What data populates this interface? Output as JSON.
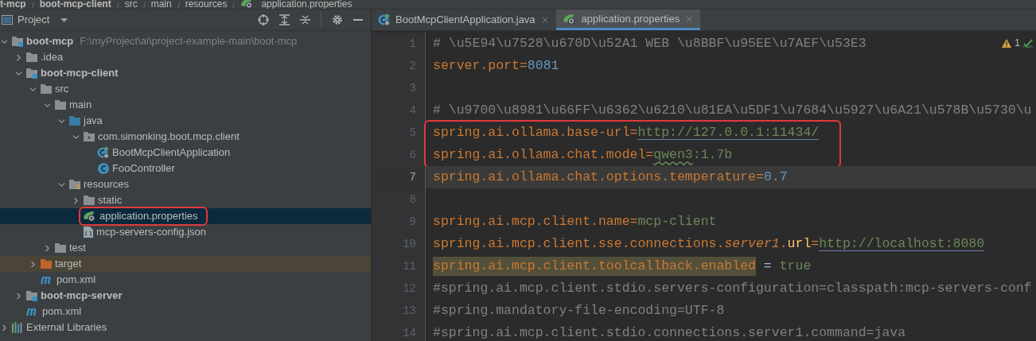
{
  "breadcrumb": [
    {
      "label": "t-mcp",
      "kind": "module"
    },
    {
      "label": "boot-mcp-client",
      "kind": "module"
    },
    {
      "label": "src",
      "kind": "folder"
    },
    {
      "label": "main",
      "kind": "folder"
    },
    {
      "label": "resources",
      "kind": "folder"
    },
    {
      "label": "application.properties",
      "kind": "spring_props"
    }
  ],
  "project_panel": {
    "title": "Project"
  },
  "tree": [
    {
      "label": "boot-mcp",
      "path": "F:\\myProject\\ai\\project-example-main\\boot-mcp",
      "kind": "module",
      "expanded": true,
      "selected": false,
      "excluded": false,
      "annotated": false,
      "children": [
        {
          "label": ".idea",
          "kind": "folder",
          "expanded": false,
          "selected": false,
          "excluded": false,
          "annotated": false
        },
        {
          "label": "boot-mcp-client",
          "kind": "module",
          "expanded": true,
          "selected": false,
          "excluded": false,
          "annotated": false,
          "children": [
            {
              "label": "src",
              "kind": "folder",
              "expanded": true,
              "selected": false,
              "excluded": false,
              "annotated": false,
              "children": [
                {
                  "label": "main",
                  "kind": "folder",
                  "expanded": true,
                  "selected": false,
                  "excluded": false,
                  "annotated": false,
                  "children": [
                    {
                      "label": "java",
                      "kind": "source_folder",
                      "expanded": true,
                      "selected": false,
                      "excluded": false,
                      "annotated": false,
                      "children": [
                        {
                          "label": "com.simonking.boot.mcp.client",
                          "kind": "package",
                          "expanded": true,
                          "selected": false,
                          "excluded": false,
                          "annotated": false,
                          "children": [
                            {
                              "label": "BootMcpClientApplication",
                              "kind": "spring_class",
                              "selected": false,
                              "excluded": false,
                              "annotated": false
                            },
                            {
                              "label": "FooController",
                              "kind": "class",
                              "selected": false,
                              "excluded": false,
                              "annotated": false
                            }
                          ]
                        }
                      ]
                    },
                    {
                      "label": "resources",
                      "kind": "resources_folder",
                      "expanded": true,
                      "selected": false,
                      "excluded": false,
                      "annotated": false,
                      "children": [
                        {
                          "label": "static",
                          "kind": "folder",
                          "expanded": false,
                          "selected": false,
                          "excluded": false,
                          "annotated": false
                        },
                        {
                          "label": "application.properties",
                          "kind": "spring_props",
                          "selected": true,
                          "excluded": false,
                          "annotated": true
                        },
                        {
                          "label": "mcp-servers-config.json",
                          "kind": "json",
                          "selected": false,
                          "excluded": false,
                          "annotated": false
                        }
                      ]
                    }
                  ]
                },
                {
                  "label": "test",
                  "kind": "folder",
                  "expanded": false,
                  "selected": false,
                  "excluded": false,
                  "annotated": false
                }
              ]
            },
            {
              "label": "target",
              "kind": "excluded_folder",
              "expanded": false,
              "selected": false,
              "excluded": true,
              "annotated": false
            },
            {
              "label": "pom.xml",
              "kind": "maven",
              "selected": false,
              "excluded": false,
              "annotated": false
            }
          ]
        },
        {
          "label": "boot-mcp-server",
          "kind": "module",
          "expanded": false,
          "selected": false,
          "excluded": false,
          "annotated": false
        },
        {
          "label": "pom.xml",
          "kind": "maven",
          "selected": false,
          "excluded": false,
          "annotated": false
        }
      ]
    },
    {
      "label": "External Libraries",
      "kind": "libraries",
      "expanded": false,
      "selected": false,
      "excluded": false,
      "annotated": false
    }
  ],
  "tabs": [
    {
      "label": "BootMcpClientApplication.java",
      "kind": "spring_class",
      "selected": false
    },
    {
      "label": "application.properties",
      "kind": "spring_props",
      "selected": true
    }
  ],
  "inspections": {
    "warnings": "1"
  },
  "code_lines": [
    {
      "number": "1",
      "current": false,
      "boxed": false,
      "segments": [
        {
          "text": "# \\u5E94\\u7528\\u670D\\u52A1 WEB \\u8BBF\\u95EE\\u7AEF\\u53E3",
          "kind": "comment"
        }
      ]
    },
    {
      "number": "2",
      "current": false,
      "boxed": false,
      "segments": [
        {
          "text": "server.port",
          "kind": "key"
        },
        {
          "text": "=",
          "kind": "sep"
        },
        {
          "text": "8081",
          "kind": "number"
        }
      ]
    },
    {
      "number": "3",
      "current": false,
      "boxed": false
    },
    {
      "number": "4",
      "current": false,
      "boxed": false,
      "segments": [
        {
          "text": "# \\u9700\\u8981\\u66FF\\u6362\\u6210\\u81EA\\u5DF1\\u7684\\u5927\\u6A21\\u578B\\u5730\\u",
          "kind": "comment"
        }
      ]
    },
    {
      "number": "5",
      "current": false,
      "boxed": true,
      "segments": [
        {
          "text": "spring.ai.ollama.base-url",
          "kind": "key"
        },
        {
          "text": "=",
          "kind": "sep"
        },
        {
          "text": "http://127.0.0.1:11434/",
          "kind": "url"
        }
      ]
    },
    {
      "number": "6",
      "current": false,
      "boxed": true,
      "segments": [
        {
          "text": "spring.ai.ollama.chat.model",
          "kind": "key"
        },
        {
          "text": "=",
          "kind": "sep"
        },
        {
          "text": "qwen3",
          "kind": "typo"
        },
        {
          "text": ":1.7b",
          "kind": "value"
        }
      ]
    },
    {
      "number": "7",
      "current": true,
      "boxed": false,
      "segments": [
        {
          "text": "spring.ai.ollama.chat.options.temperature",
          "kind": "key"
        },
        {
          "text": "=",
          "kind": "sep"
        },
        {
          "text": "0.7",
          "kind": "number"
        }
      ]
    },
    {
      "number": "8",
      "current": false,
      "boxed": false
    },
    {
      "number": "9",
      "current": false,
      "boxed": false,
      "segments": [
        {
          "text": "spring.ai.mcp.client.name",
          "kind": "key"
        },
        {
          "text": "=",
          "kind": "sep"
        },
        {
          "text": "mcp-client",
          "kind": "value"
        }
      ]
    },
    {
      "number": "10",
      "current": false,
      "boxed": false,
      "segments": [
        {
          "text": "spring.ai.mcp.client.sse.connections.",
          "kind": "key"
        },
        {
          "text": "server1",
          "kind": "italic_key"
        },
        {
          "text": ".",
          "kind": "key"
        },
        {
          "text": "url",
          "kind": "attr"
        },
        {
          "text": "=",
          "kind": "sep"
        },
        {
          "text": "http://localhost:8080",
          "kind": "url"
        }
      ]
    },
    {
      "number": "11",
      "current": false,
      "boxed": false,
      "segments": [
        {
          "text": "spring.ai.mcp.client.toolcallback.enabled",
          "kind": "highlighted_key"
        },
        {
          "text": " = ",
          "kind": "plain"
        },
        {
          "text": "true",
          "kind": "value"
        }
      ]
    },
    {
      "number": "12",
      "current": false,
      "boxed": false,
      "segments": [
        {
          "text": "#spring.ai.mcp.client.stdio.servers-configuration=classpath:mcp-servers-conf",
          "kind": "comment"
        }
      ]
    },
    {
      "number": "13",
      "current": false,
      "boxed": false,
      "segments": [
        {
          "text": "#spring.mandatory-file-encoding=UTF-8",
          "kind": "comment"
        }
      ]
    },
    {
      "number": "14",
      "current": false,
      "boxed": false,
      "segments": [
        {
          "text": "#spring.ai.mcp.client.stdio.connections.server1.command=java",
          "kind": "comment"
        }
      ]
    }
  ]
}
